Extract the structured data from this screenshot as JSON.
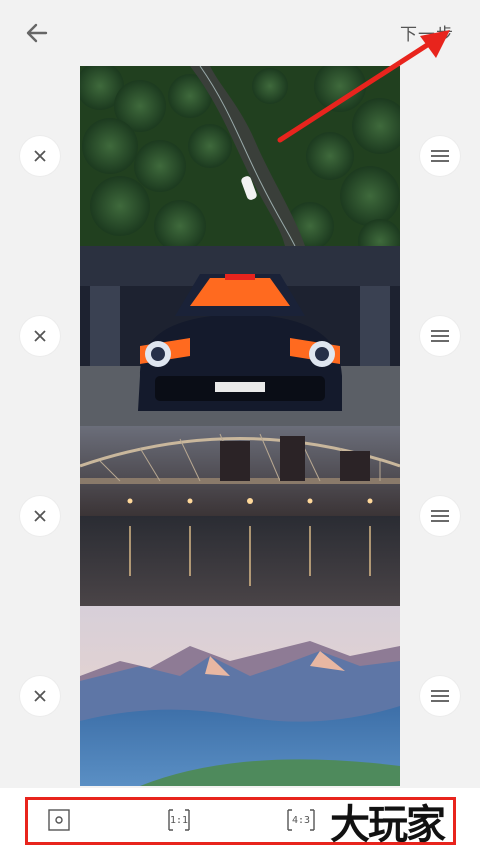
{
  "header": {
    "back_icon": "arrow-left-icon",
    "next_label": "下一步"
  },
  "photos": [
    {
      "name": "forest-road"
    },
    {
      "name": "porsche-race-car"
    },
    {
      "name": "bridge-night"
    },
    {
      "name": "mountain-valley"
    }
  ],
  "side_actions": {
    "remove_icon": "close-icon",
    "reorder_icon": "drag-handle-icon"
  },
  "bottom_bar": {
    "ratios": [
      {
        "icon": "original-ratio-icon",
        "label": ""
      },
      {
        "icon": "ratio-1-1-icon",
        "label": "1:1"
      },
      {
        "icon": "ratio-4-3-icon",
        "label": "4:3"
      }
    ]
  },
  "watermark": "大玩家",
  "colors": {
    "annotation_red": "#e8241d",
    "background": "#f2f2f2"
  }
}
